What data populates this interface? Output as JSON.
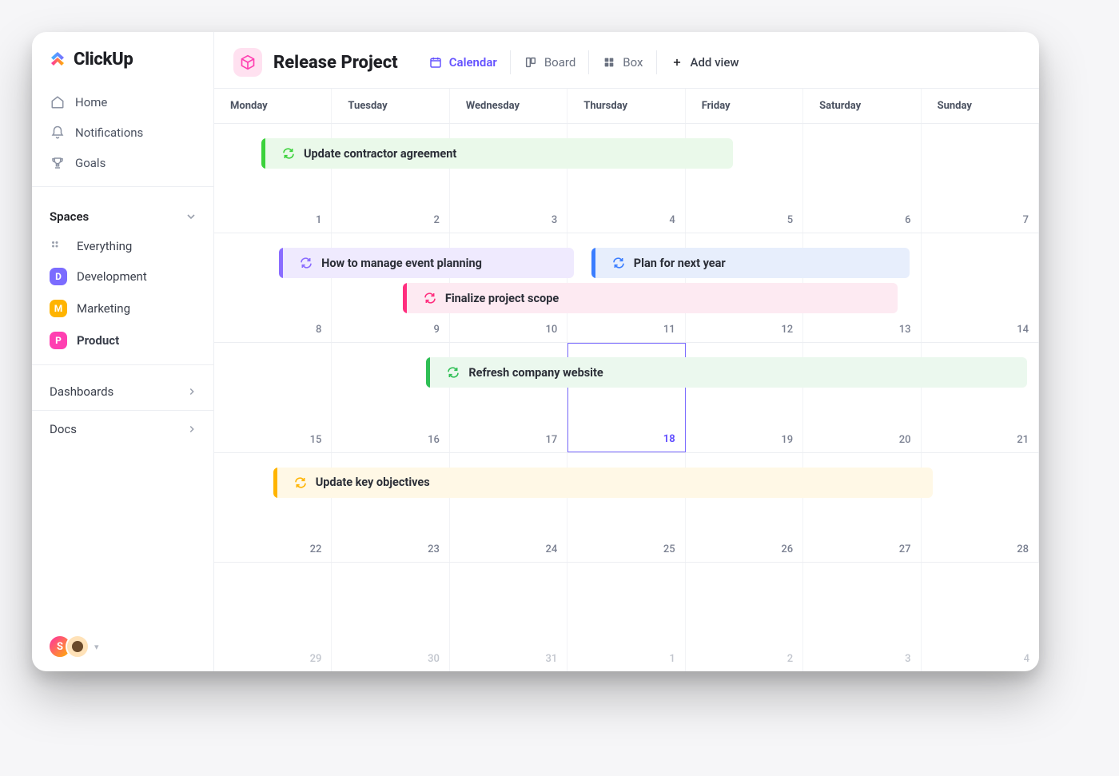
{
  "brand": {
    "name": "ClickUp"
  },
  "sidebar": {
    "nav": [
      {
        "label": "Home"
      },
      {
        "label": "Notifications"
      },
      {
        "label": "Goals"
      }
    ],
    "spaces_header": "Spaces",
    "everything": "Everything",
    "spaces": [
      {
        "letter": "D",
        "label": "Development",
        "color": "#7b6cff"
      },
      {
        "letter": "M",
        "label": "Marketing",
        "color": "#ffb400"
      },
      {
        "letter": "P",
        "label": "Product",
        "color": "#ff3fb1",
        "active": true
      }
    ],
    "dashboards": "Dashboards",
    "docs": "Docs",
    "user_initial": "S"
  },
  "header": {
    "project_title": "Release Project",
    "views": {
      "calendar": "Calendar",
      "board": "Board",
      "box": "Box",
      "add": "Add view"
    }
  },
  "calendar": {
    "days": [
      "Monday",
      "Tuesday",
      "Wednesday",
      "Thursday",
      "Friday",
      "Saturday",
      "Sunday"
    ],
    "today": 18,
    "weeks": [
      {
        "dates": [
          1,
          2,
          3,
          4,
          5,
          6,
          7
        ],
        "muted": false
      },
      {
        "dates": [
          8,
          9,
          10,
          11,
          12,
          13,
          14
        ],
        "muted": false
      },
      {
        "dates": [
          15,
          16,
          17,
          18,
          19,
          20,
          21
        ],
        "muted": false
      },
      {
        "dates": [
          22,
          23,
          24,
          25,
          26,
          27,
          28
        ],
        "muted": false
      },
      {
        "dates": [
          29,
          30,
          31,
          1,
          2,
          3,
          4
        ],
        "muted": true
      }
    ],
    "events": [
      {
        "week": 0,
        "row": 1,
        "start": 0,
        "span": 4.0,
        "theme": "green",
        "offset": 0.4,
        "title": "Update contractor agreement"
      },
      {
        "week": 1,
        "row": 1,
        "start": 0,
        "span": 2.5,
        "theme": "purple",
        "offset": 0.55,
        "title": "How to manage event planning"
      },
      {
        "week": 1,
        "row": 1,
        "start": 3,
        "span": 2.7,
        "theme": "blue",
        "offset": 0.2,
        "title": "Plan for next year"
      },
      {
        "week": 1,
        "row": 2,
        "start": 1,
        "span": 4.2,
        "theme": "pink",
        "offset": 0.6,
        "title": "Finalize project scope"
      },
      {
        "week": 2,
        "row": 1,
        "start": 1,
        "span": 5.1,
        "theme": "green2",
        "offset": 0.8,
        "title": "Refresh company website"
      },
      {
        "week": 3,
        "row": 1,
        "start": 0,
        "span": 5.6,
        "theme": "yellow",
        "offset": 0.5,
        "title": "Update key objectives"
      }
    ]
  }
}
